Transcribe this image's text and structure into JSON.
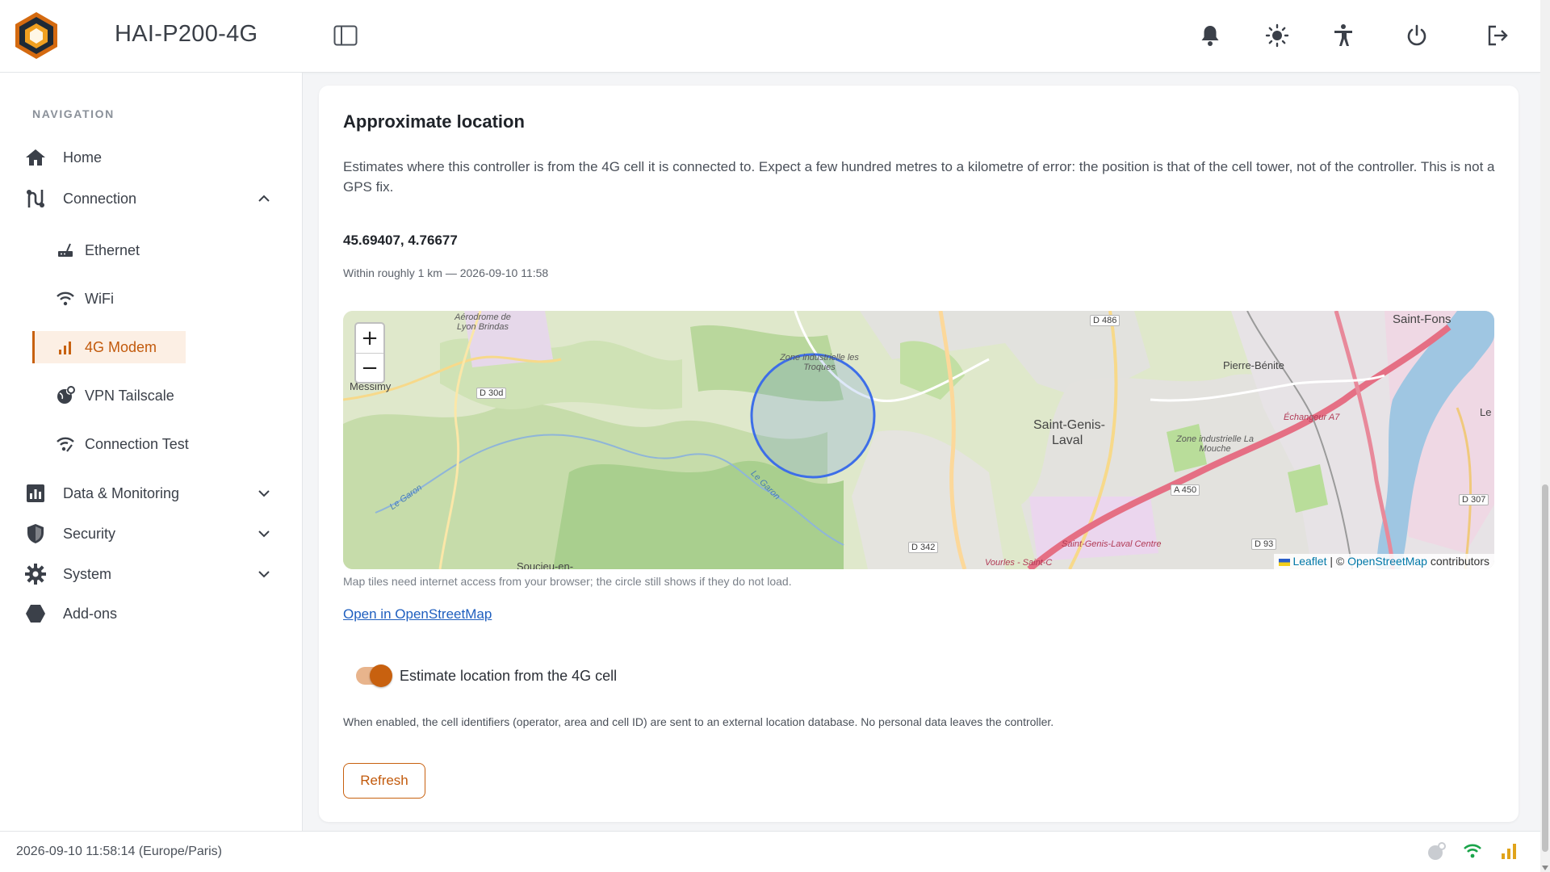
{
  "app": {
    "title": "HAI-P200-4G"
  },
  "header": {
    "icons": [
      "notification-bell-icon",
      "theme-sun-icon",
      "accessibility-icon",
      "power-icon",
      "logout-icon"
    ]
  },
  "sidebar": {
    "heading": "NAVIGATION",
    "items": [
      {
        "label": "Home",
        "icon": "home-icon"
      },
      {
        "label": "Connection",
        "icon": "connection-icon",
        "expanded": true,
        "children": [
          {
            "label": "Ethernet",
            "icon": "ethernet-icon"
          },
          {
            "label": "WiFi",
            "icon": "wifi-icon"
          },
          {
            "label": "4G Modem",
            "icon": "signal-bars-icon",
            "active": true
          },
          {
            "label": "VPN Tailscale",
            "icon": "vpn-globe-icon"
          },
          {
            "label": "Connection Test",
            "icon": "connection-test-icon"
          }
        ]
      },
      {
        "label": "Data & Monitoring",
        "icon": "chart-icon",
        "expanded": false
      },
      {
        "label": "Security",
        "icon": "shield-icon",
        "expanded": false
      },
      {
        "label": "System",
        "icon": "gear-icon",
        "expanded": false
      },
      {
        "label": "Add-ons",
        "icon": "hexagon-icon"
      }
    ]
  },
  "location": {
    "title": "Approximate location",
    "description": "Estimates where this controller is from the 4G cell it is connected to. Expect a few hundred metres to a kilometre of error: the position is that of the cell tower, not of the controller. This is not a GPS fix.",
    "coordinates": "45.69407, 4.76677",
    "accuracy": "Within roughly 1 km — 2026-09-10 11:58",
    "map": {
      "zoom_in": "+",
      "zoom_out": "−",
      "attribution_leaflet": "Leaflet",
      "attribution_sep": " | © ",
      "attribution_osm": "OpenStreetMap",
      "attribution_suffix": " contributors",
      "labels": {
        "aerodrome": "Aérodrome de Lyon Brindas",
        "messimy": "Messimy",
        "zone_troques": "Zone industrielle les Troques",
        "saint_genis_1": "Saint-Genis-",
        "saint_genis_2": "Laval",
        "pierre_benite": "Pierre-Bénite",
        "saint_fons": "Saint-Fons",
        "zone_mouche": "Zone industrielle La Mouche",
        "echangeur": "Échangeur A7",
        "sg_centre": "Saint-Genis-Laval Centre",
        "vourles": "Vourles - Saint-C",
        "soucieu": "Soucieu-en-",
        "garon_1": "Le Garon",
        "garon_2": "Le Garon",
        "le": "Le"
      },
      "roads": {
        "d30d": "D 30d",
        "d486": "D 486",
        "a450": "A 450",
        "d342": "D 342",
        "d93": "D 93",
        "d307": "D 307"
      }
    },
    "map_hint": "Map tiles need internet access from your browser; the circle still shows if they do not load.",
    "osm_link": "Open in OpenStreetMap",
    "toggle_label": "Estimate location from the 4G cell",
    "toggle_on": true,
    "privacy_note": "When enabled, the cell identifiers (operator, area and cell ID) are sent to an external location database. No personal data leaves the controller.",
    "refresh_label": "Refresh"
  },
  "footer": {
    "datetime": "2026-09-10 11:58:14 (Europe/Paris)",
    "status_icons": [
      "vpn-status-icon",
      "wifi-status-icon",
      "cellular-signal-icon"
    ]
  },
  "colors": {
    "accent": "#c8610f",
    "accent_light": "#fcefe4",
    "status_green": "#1aa44a",
    "status_signal": "#e0a31a"
  }
}
